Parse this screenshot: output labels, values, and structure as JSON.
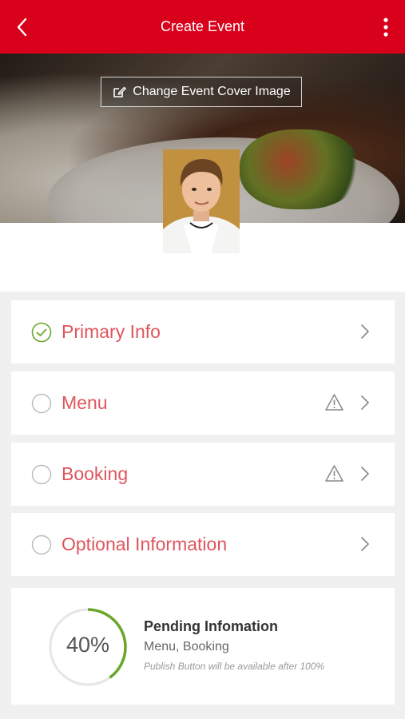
{
  "header": {
    "title": "Create Event"
  },
  "cover": {
    "change_label": "Change Event Cover Image"
  },
  "sections": [
    {
      "label": "Primary Info",
      "state": "complete",
      "warning": false
    },
    {
      "label": "Menu",
      "state": "pending",
      "warning": true
    },
    {
      "label": "Booking",
      "state": "pending",
      "warning": true
    },
    {
      "label": "Optional Information",
      "state": "pending",
      "warning": false
    }
  ],
  "progress": {
    "value": 0.4,
    "percent_label": "40%",
    "title": "Pending Infomation",
    "items": "Menu, Booking",
    "note": "Publish Button will be available after 100%"
  },
  "colors": {
    "brand": "#d9001b",
    "section_label": "#e0555d",
    "complete": "#6aa628",
    "progress": "#6aa628"
  }
}
